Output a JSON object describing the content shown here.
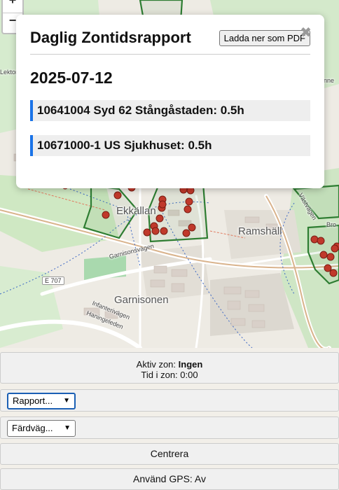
{
  "map": {
    "zoom_in": "+",
    "zoom_out": "−",
    "labels": {
      "ekkallan": "Ekkällan",
      "ramshall": "Ramshäll",
      "garnisonen": "Garnisonen",
      "garnisonsvagen": "Garnisonsvägen",
      "infanterivagen": "Infanterivägen",
      "haningeleden": "Haningeleden",
      "e707": "E 707",
      "vastvagen": "Västvägen",
      "bro": "Bro",
      "lektora": "Lektora",
      "nne": "nne"
    },
    "colors": {
      "zone": "#2e7d32",
      "marker": "#c0392b"
    }
  },
  "modal": {
    "title": "Daglig Zontidsrapport",
    "pdf_button": "Ladda ner som PDF",
    "close": "✖",
    "date": "2025-07-12",
    "entries": [
      "10641004 Syd 62 Stångåstaden: 0.5h",
      "10671000-1 US Sjukhuset: 0.5h"
    ]
  },
  "controls": {
    "active_zone_label": "Aktiv zon: ",
    "active_zone_value": "Ingen",
    "time_in_zone": "Tid i zon: 0:00",
    "report_select": "Rapport...",
    "route_select": "Färdväg...",
    "center_button": "Centrera",
    "gps_button": "Använd GPS: Av"
  }
}
